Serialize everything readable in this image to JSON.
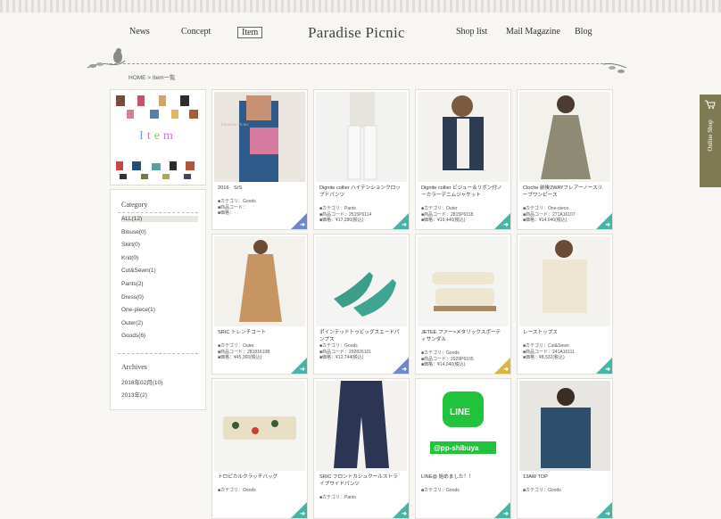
{
  "nav": {
    "left": [
      "News",
      "Concept",
      "Item"
    ],
    "right": [
      "Shop list",
      "Mail Magazine",
      "Blog"
    ],
    "active": "Item"
  },
  "logo": "Paradise Picnic",
  "breadcrumb": "HOME > Item一覧",
  "item_banner": "Item",
  "sidebar": {
    "category_title": "Category",
    "categories": [
      "ALL(12)",
      "Blouse(0)",
      "Skirt(0)",
      "Knit(0)",
      "Cut&Sewn(1)",
      "Pants(2)",
      "Dress(0)",
      "One-piece(1)",
      "Outer(2)",
      "Goods(6)"
    ],
    "archives_title": "Archives",
    "archives": [
      "2016年02月(10)",
      "2013年(2)"
    ]
  },
  "shop_tab": {
    "label": "Online Shop",
    "icon": "cart-icon"
  },
  "products": [
    {
      "name": "2016　S/S",
      "category": "■カテゴリ：Goods",
      "code": "■商品コード：",
      "price": "■価格：",
      "corner": "blue"
    },
    {
      "name": "Dignite collier ハイテンションクロップドパンツ",
      "category": "■カテゴリ：Pants",
      "code": "■商品コード：2515P6114",
      "price": "■価格：¥17,280(税込)",
      "corner": "teal"
    },
    {
      "name": "Dignite collier ビジュー＆リボン付ノーカラーデニムジャケット",
      "category": "■カテゴリ：Outer",
      "code": "■商品コード：2815P6118",
      "price": "■価格：¥19,440(税込)",
      "corner": "teal"
    },
    {
      "name": "Cloche 前後2WAYフレアーノースリーブワンピース",
      "category": "■カテゴリ：One-piece",
      "code": "■商品コード：271A16107",
      "price": "■価格：¥14,040(税込)",
      "corner": "teal"
    },
    {
      "name": "SRIC トレンチコート",
      "category": "■カテゴリ：Outer",
      "code": "■商品コード：28181610B",
      "price": "■価格：¥45,360(税込)",
      "corner": "teal"
    },
    {
      "name": "ポインテッドトゥビッグスエードパンプス",
      "category": "■カテゴリ：Goods",
      "code": "■商品コード：292826101",
      "price": "■価格：¥12,744(税込)",
      "corner": "blue"
    },
    {
      "name": "JETEE ファー×メタリックスポーティサンダル",
      "category": "■カテゴリ：Goods",
      "code": "■商品コード：2929P6105",
      "price": "■価格：¥14,040(税込)",
      "corner": "gold"
    },
    {
      "name": "レーストップス",
      "category": "■カテゴリ：Cut&Sewn",
      "code": "■商品コード：241A16111",
      "price": "■価格：¥8,532(税込)",
      "corner": "teal"
    },
    {
      "name": "トロピカルクラッチバッグ",
      "category": "■カテゴリ：Goods",
      "code": "",
      "price": "",
      "corner": "teal"
    },
    {
      "name": "SRIC フロントカシュクールストライプワイドパンツ",
      "category": "■カテゴリ：Pants",
      "code": "",
      "price": "",
      "corner": "teal"
    },
    {
      "name": "LINE@ 始めました！！",
      "category": "■カテゴリ：Goods",
      "code": "",
      "price": "",
      "corner": "teal"
    },
    {
      "name": "13AW TOP",
      "category": "■カテゴリ：Goods",
      "code": "",
      "price": "",
      "corner": "teal"
    }
  ],
  "line_image": {
    "logo": "LINE",
    "handle": "@pp-shibuya"
  },
  "colors": {
    "teal": "#46b4a7",
    "blue": "#6f86c8",
    "gold": "#d7b63e",
    "shop_tab": "#7e7b54",
    "line_green": "#21c33a"
  }
}
